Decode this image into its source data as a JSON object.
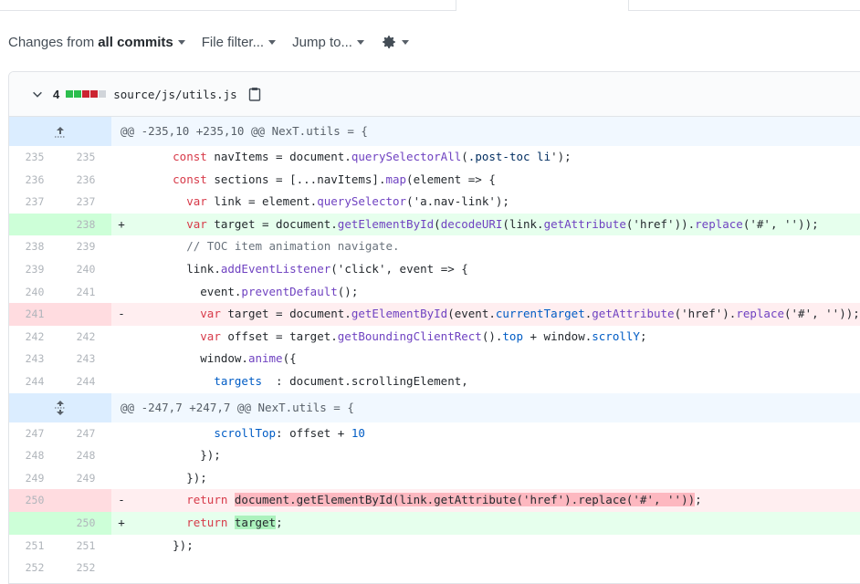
{
  "toolbar": {
    "changes_prefix": "Changes from",
    "changes_value": "all commits",
    "file_filter": "File filter...",
    "jump_to": "Jump to..."
  },
  "file": {
    "count": "4",
    "path": "source/js/utils.js",
    "diffstat_colors": [
      "#2cbe4e",
      "#2cbe4e",
      "#cb2431",
      "#cb2431",
      "#d1d5da"
    ]
  },
  "hunks": [
    {
      "header": "@@ -235,10 +235,10 @@ NexT.utils = {"
    },
    {
      "header": "@@ -247,7 +247,7 @@ NexT.utils = {"
    }
  ],
  "lines": [
    {
      "old": "235",
      "new": "235",
      "sign": "",
      "type": "ctx"
    },
    {
      "old": "236",
      "new": "236",
      "sign": "",
      "type": "ctx"
    },
    {
      "old": "237",
      "new": "237",
      "sign": "",
      "type": "ctx"
    },
    {
      "old": "",
      "new": "238",
      "sign": "+",
      "type": "add"
    },
    {
      "old": "238",
      "new": "239",
      "sign": "",
      "type": "ctx"
    },
    {
      "old": "239",
      "new": "240",
      "sign": "",
      "type": "ctx"
    },
    {
      "old": "240",
      "new": "241",
      "sign": "",
      "type": "ctx"
    },
    {
      "old": "241",
      "new": "",
      "sign": "-",
      "type": "del"
    },
    {
      "old": "242",
      "new": "242",
      "sign": "",
      "type": "ctx"
    },
    {
      "old": "243",
      "new": "243",
      "sign": "",
      "type": "ctx"
    },
    {
      "old": "244",
      "new": "244",
      "sign": "",
      "type": "ctx"
    },
    {
      "old": "247",
      "new": "247",
      "sign": "",
      "type": "ctx"
    },
    {
      "old": "248",
      "new": "248",
      "sign": "",
      "type": "ctx"
    },
    {
      "old": "249",
      "new": "249",
      "sign": "",
      "type": "ctx"
    },
    {
      "old": "250",
      "new": "",
      "sign": "-",
      "type": "del"
    },
    {
      "old": "",
      "new": "250",
      "sign": "+",
      "type": "add"
    },
    {
      "old": "251",
      "new": "251",
      "sign": "",
      "type": "ctx"
    },
    {
      "old": "252",
      "new": "252",
      "sign": "",
      "type": "ctx"
    }
  ],
  "code": {
    "l0": [
      "      ",
      "const",
      " navItems = document.",
      "querySelectorAll",
      "(",
      ".post-toc li",
      "');"
    ],
    "l1": [
      "      ",
      "const",
      " sections = [...navItems].",
      "map",
      "(element => {"
    ],
    "l2": [
      "        ",
      "var",
      " link = element.",
      "querySelector",
      "('a.nav-link');"
    ],
    "l3": [
      "        ",
      "var",
      " target = document.",
      "getElementById",
      "(",
      "decodeURI",
      "(link.",
      "getAttribute",
      "('href')).",
      "replace",
      "('#', ''));"
    ],
    "l4": [
      "        ",
      "// TOC item animation navigate."
    ],
    "l5": [
      "        ",
      "link.",
      "addEventListener",
      "('click', event => {"
    ],
    "l6": [
      "          ",
      "event.",
      "preventDefault",
      "();"
    ],
    "l7": [
      "          ",
      "var",
      " target = document.",
      "getElementById",
      "(event.",
      "currentTarget",
      ".",
      "getAttribute",
      "('href').",
      "replace",
      "('#', ''));"
    ],
    "l8": [
      "          ",
      "var",
      " offset = target.",
      "getBoundingClientRect",
      "().",
      "top",
      " + window.",
      "scrollY",
      ";"
    ],
    "l9": [
      "          ",
      "window.",
      "anime",
      "({"
    ],
    "l10": [
      "            ",
      "targets",
      "  : document.scrollingElement,"
    ],
    "l11": [
      "            ",
      "scrollTop",
      ": offset + ",
      "10"
    ],
    "l12": [
      "          });"
    ],
    "l13": [
      "        });"
    ],
    "l14": [
      "        ",
      "return",
      " ",
      "document.getElementById(link.getAttribute('href').replace('#', ''))",
      ";"
    ],
    "l15": [
      "        ",
      "return",
      " ",
      "target",
      ";"
    ],
    "l16": [
      "      });"
    ],
    "l17": [
      ""
    ]
  }
}
